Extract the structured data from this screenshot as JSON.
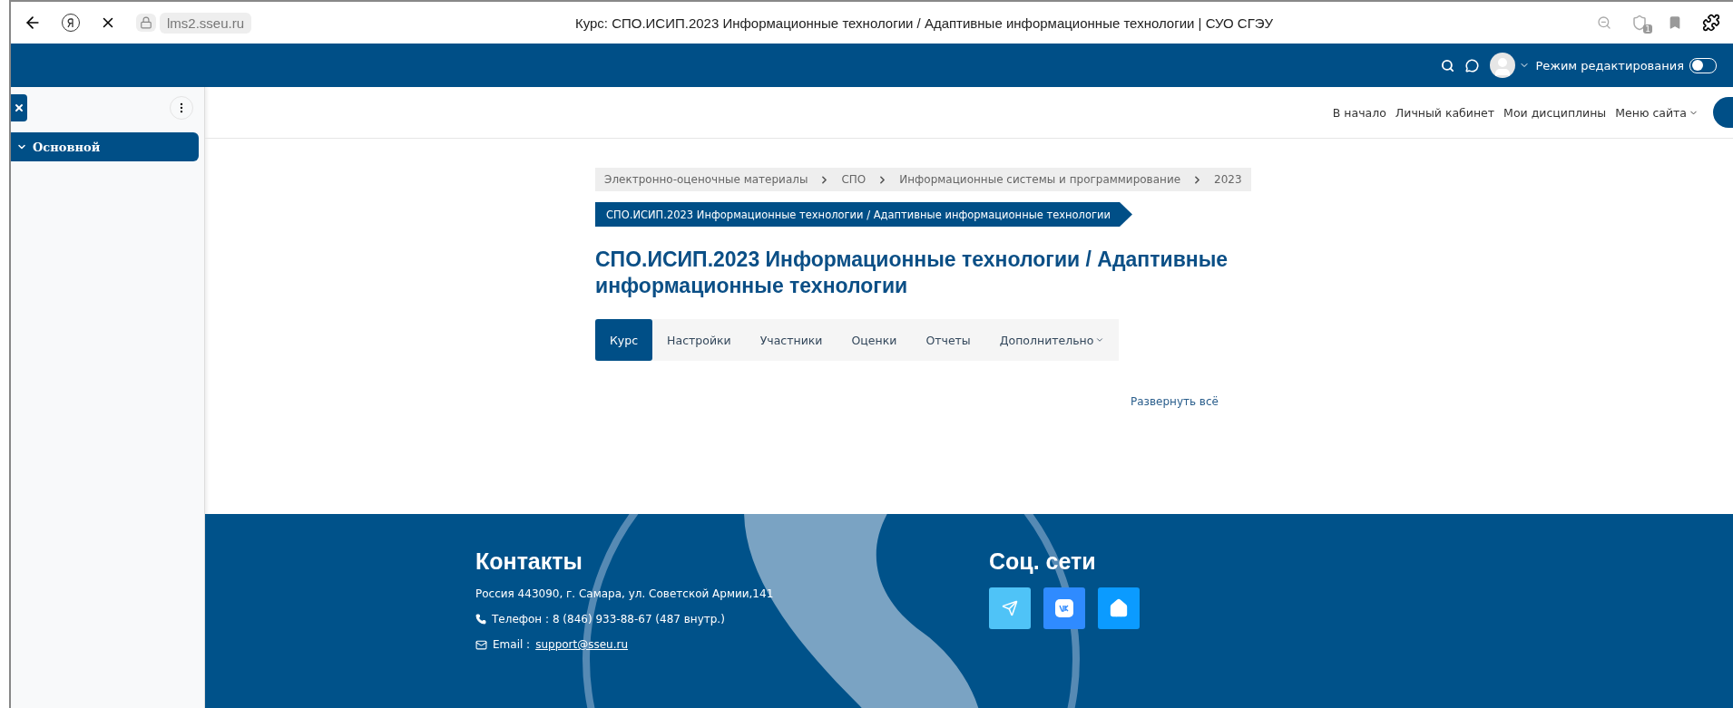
{
  "browser": {
    "url": "lms2.sseu.ru",
    "title": "Курс: СПО.ИСИП.2023 Информационные технологии / Адаптивные информационные технологии | СУО СГЭУ",
    "notification_count": "1"
  },
  "navbar": {
    "edit_mode_label": "Режим редактирования",
    "edit_mode_on": false
  },
  "drawer": {
    "items": [
      {
        "label": "Основной",
        "expanded": true,
        "selected": true
      }
    ]
  },
  "top_nav": {
    "links": [
      {
        "label": "В начало",
        "has_menu": false
      },
      {
        "label": "Личный кабинет",
        "has_menu": false
      },
      {
        "label": "Мои дисциплины",
        "has_menu": false
      },
      {
        "label": "Меню сайта",
        "has_menu": true
      }
    ]
  },
  "breadcrumb": [
    "Электронно-оценочные материалы",
    "СПО",
    "Информационные системы и программирование",
    "2023"
  ],
  "course_badge": "СПО.ИСИП.2023 Информационные технологии / Адаптивные информационные технологии",
  "page_title": "СПО.ИСИП.2023 Информационные технологии / Адаптивные информационные технологии",
  "tabs": [
    {
      "label": "Курс",
      "selected": true,
      "has_menu": false
    },
    {
      "label": "Настройки",
      "selected": false,
      "has_menu": false
    },
    {
      "label": "Участники",
      "selected": false,
      "has_menu": false
    },
    {
      "label": "Оценки",
      "selected": false,
      "has_menu": false
    },
    {
      "label": "Отчеты",
      "selected": false,
      "has_menu": false
    },
    {
      "label": "Дополнительно",
      "selected": false,
      "has_menu": true
    }
  ],
  "expand_all": "Развернуть всё",
  "footer": {
    "contacts_title": "Контакты",
    "address": "Россия 443090, г. Самара, ул. Советской Армии,141",
    "phone": "Телефон : 8 (846) 933-88-67 (487 внутр.)",
    "email_label": "Email :",
    "email": "support@sseu.ru",
    "social_title": "Соц. сети",
    "social": [
      {
        "kind": "telegram",
        "color": "#4fc3f7"
      },
      {
        "kind": "vk",
        "color": "#2f8bff"
      },
      {
        "kind": "home",
        "color": "#0b9bff"
      }
    ]
  }
}
